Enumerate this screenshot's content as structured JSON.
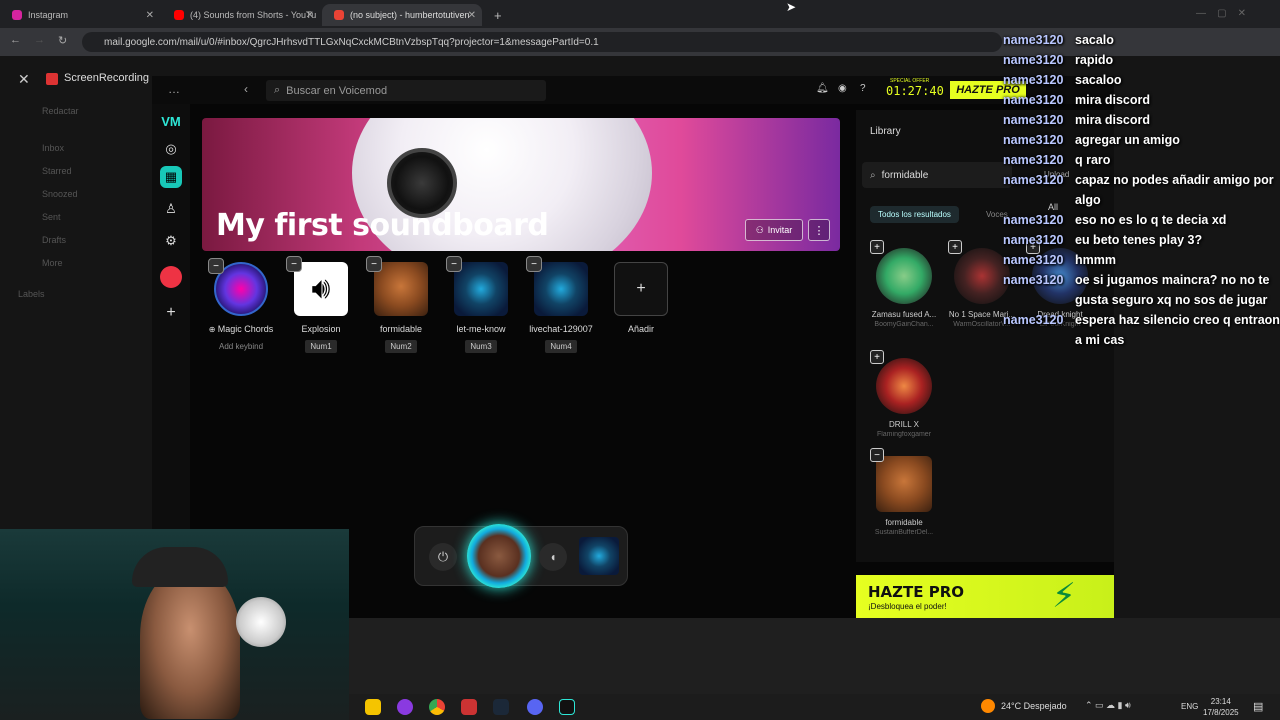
{
  "browser": {
    "tabs": [
      {
        "label": "Instagram",
        "color": "#d6249f"
      },
      {
        "label": "(4) Sounds from Shorts - YouTu",
        "color": "#ff0000"
      },
      {
        "label": "(no subject) - humbertotutiven",
        "color": "#ea4335"
      }
    ],
    "url": "mail.google.com/mail/u/0/#inbox/QgrcJHrhsvdTTLGxNqCxckMCBtnVzbspTqq?projector=1&messageP​artId=0.1",
    "new_tab": "+"
  },
  "gmail": {
    "attachment_title": "ScreenRecording",
    "sidebar": [
      "Redactar",
      "Inbox",
      "Starred",
      "Snoozed",
      "Sent",
      "Drafts",
      "More",
      "Labels"
    ]
  },
  "voicemod": {
    "search_placeholder": "Buscar en Voicemod",
    "offer_label": "SPECIAL OFFER",
    "timer": "01:27:40",
    "pro_label": "HAZTE PRO",
    "banner_title": "My first soundboard",
    "invite_label": "Invitar",
    "more_label": "⋮",
    "sounds": [
      {
        "name": "Magic Chords",
        "key": "Add keybind",
        "art": "magic"
      },
      {
        "name": "Explosion",
        "key": "Num1",
        "art": "speaker"
      },
      {
        "name": "formidable",
        "key": "Num2",
        "art": "dog"
      },
      {
        "name": "let-me-know",
        "key": "Num3",
        "art": "wave"
      },
      {
        "name": "livechat-129007",
        "key": "Num4",
        "art": "wave"
      }
    ],
    "add_label": "Añadir",
    "add_symbol": "+",
    "library": {
      "title": "Library",
      "search_value": "formidable",
      "upload_label": "Upload",
      "filter_all": "All",
      "tab_all": "Todos los resultados",
      "tab_voices": "Voces",
      "items": [
        {
          "title": "Zamasu fused A...",
          "author": "BoomyGainChan..."
        },
        {
          "title": "No 1 Space Mari...",
          "author": "WarmOscillatorV..."
        },
        {
          "title": "Dread knight",
          "author": "ElPoorKnight"
        },
        {
          "title": "DRILL X",
          "author": "Flamingfoxgamer"
        },
        {
          "title": "formidable",
          "author": "SustainBufferDel..."
        }
      ]
    },
    "promo": {
      "title": "HAZTE PRO",
      "subtitle": "¡Desbloquea el poder!"
    }
  },
  "chat": [
    {
      "user": "name3120",
      "msg": "sacalo"
    },
    {
      "user": "name3120",
      "msg": "rapido"
    },
    {
      "user": "name3120",
      "msg": "sacaloo"
    },
    {
      "user": "name3120",
      "msg": "mira discord"
    },
    {
      "user": "name3120",
      "msg": "mira discord"
    },
    {
      "user": "name3120",
      "msg": "agregar un amigo"
    },
    {
      "user": "name3120",
      "msg": "q raro"
    },
    {
      "user": "name3120",
      "msg": "capaz no podes añadir amigo por algo"
    },
    {
      "user": "name3120",
      "msg": "eso no es lo q te decia xd"
    },
    {
      "user": "name3120",
      "msg": "eu beto tenes play 3?"
    },
    {
      "user": "name3120",
      "msg": "hmmm"
    },
    {
      "user": "name3120",
      "msg": "oe si jugamos maincra? no no te gusta seguro xq no sos de jugar"
    },
    {
      "user": "name3120",
      "msg": "espera haz silencio creo q entraon a mi cas"
    }
  ],
  "taskbar": {
    "weather": "24°C  Despejado",
    "lang": "ENG",
    "time": "23:14",
    "date": "17/8/2025"
  },
  "colors": {
    "accent": "#2ee6d6",
    "pro": "#e6ff20"
  }
}
